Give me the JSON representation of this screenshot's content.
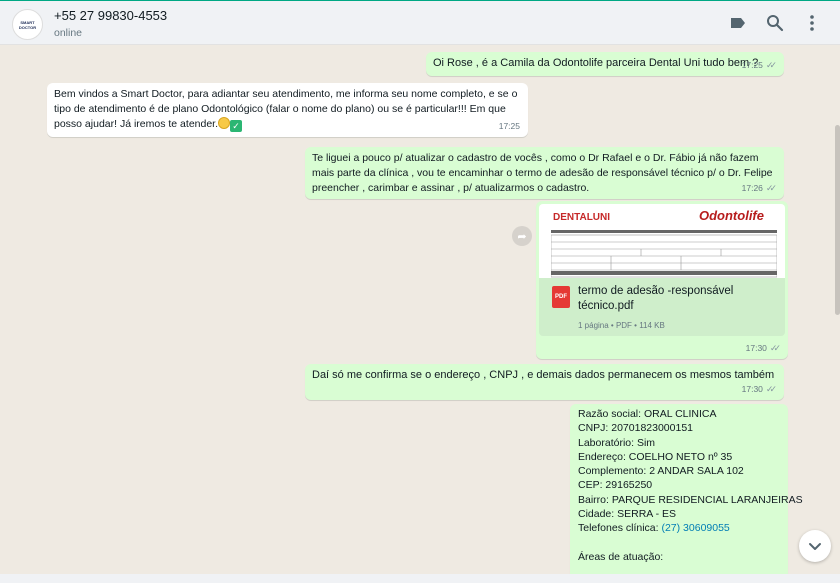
{
  "header": {
    "avatar_text": "SMART DOCTOR",
    "contact_name": "+55 27 99830-4553",
    "status": "online",
    "icons": [
      "label-icon",
      "search-icon",
      "menu-icon"
    ]
  },
  "messages": {
    "m1": {
      "text": "Oi Rose , é a Camila da Odontolife parceira Dental Uni tudo bem ?",
      "time": "17:25"
    },
    "m2": {
      "lines": [
        "Bem vindos a Smart Doctor, para adiantar seu atendimento, me informa seu nome completo, e se o",
        "tipo de atendimento é de plano Odontológico (falar o nome do plano) ou se é particular!!!  Em que",
        "posso ajudar! Já iremos te atender."
      ],
      "time": "17:25"
    },
    "m3": {
      "lines": [
        "Te liguei a pouco p/ atualizar o cadastro de vocês , como o Dr Rafael e o Dr. Fábio já não fazem",
        "mais parte da clínica , vou te encaminhar o termo de adesão de responsável técnico p/ o Dr. Felipe",
        "preencher , carimbar e assinar , p/ atualizarmos o cadastro."
      ],
      "time": "17:26"
    },
    "m4": {
      "preview_left_logo": "DENTALUNI",
      "preview_right_logo": "Odontolife",
      "file_name": "termo de adesão -responsável técnico.pdf",
      "pdf_label": "PDF",
      "meta": "1 página • PDF • 114 KB",
      "time": "17:30"
    },
    "m5": {
      "text": "Daí só me confirma se o endereço , CNPJ , e demais dados permanecem os mesmos também",
      "time": "17:30"
    },
    "m6": {
      "lines": [
        "Razão social: ORAL CLINICA",
        "CNPJ: 20701823000151",
        "Laboratório: Sim",
        "Endereço: COELHO NETO nº 35",
        "Complemento: 2 ANDAR SALA 102",
        "CEP: 29165250",
        "Bairro: PARQUE RESIDENCIAL LARANJEIRAS",
        "Cidade: SERRA - ES"
      ],
      "phone_label": "Telefones clínica: ",
      "phone_link": "(27) 30609055",
      "areas": "Áreas de atuação:"
    }
  },
  "colors": {
    "outgoing": "#d9fdd3",
    "incoming": "#ffffff",
    "accent": "#00a884",
    "link": "#027eb5"
  }
}
